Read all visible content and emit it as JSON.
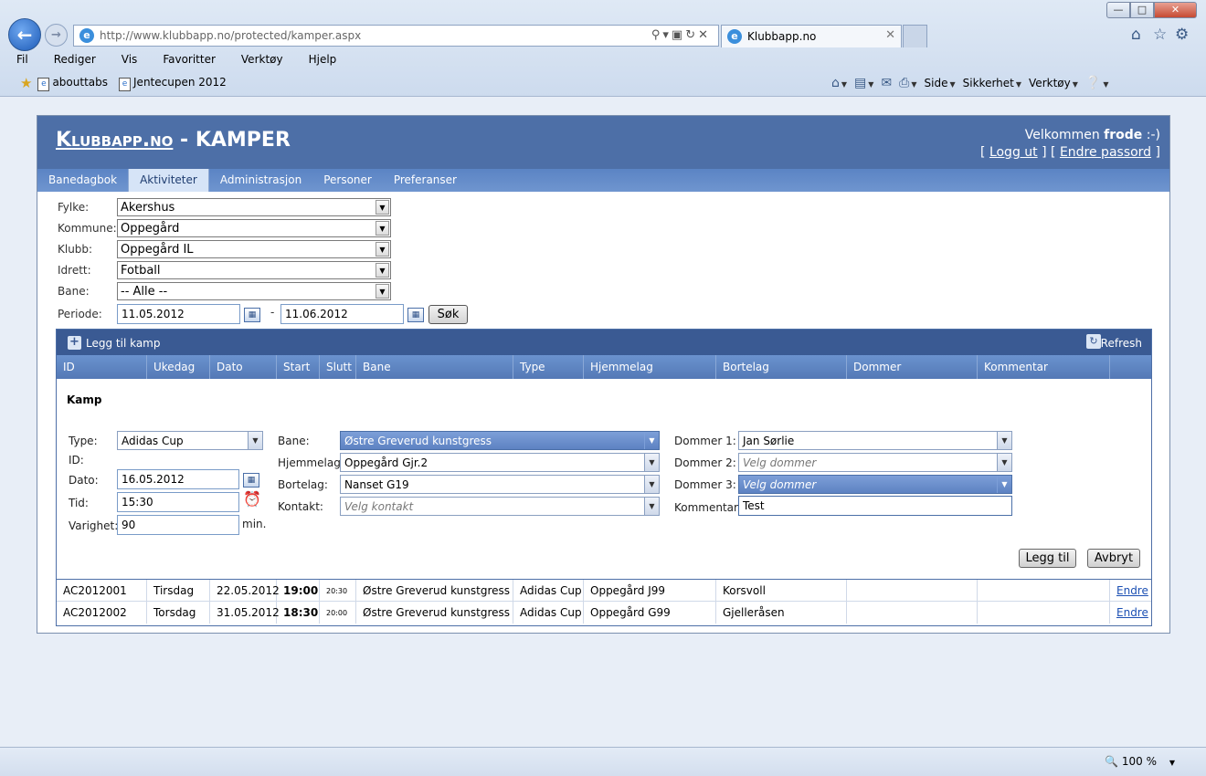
{
  "browser": {
    "url": "http://www.klubbapp.no/protected/kamper.aspx",
    "tab_title": "Klubbapp.no",
    "menu": [
      "Fil",
      "Rediger",
      "Vis",
      "Favoritter",
      "Verktøy",
      "Hjelp"
    ],
    "favorites": [
      "abouttabs",
      "Jentecupen 2012"
    ],
    "commands": [
      "Side",
      "Sikkerhet",
      "Verktøy"
    ],
    "zoom": "100 %"
  },
  "header": {
    "logo": "Klubbapp.no",
    "separator": " - ",
    "title": "KAMPER",
    "welcome_prefix": "Velkommen ",
    "username": "frode",
    "welcome_suffix": " :-)",
    "logout": "Logg ut",
    "change_password": "Endre passord"
  },
  "tabs": [
    "Banedagbok",
    "Aktiviteter",
    "Administrasjon",
    "Personer",
    "Preferanser"
  ],
  "filters": {
    "fylke_label": "Fylke:",
    "fylke": "Akershus",
    "kommune_label": "Kommune:",
    "kommune": "Oppegård",
    "klubb_label": "Klubb:",
    "klubb": "Oppegård IL",
    "idrett_label": "Idrett:",
    "idrett": "Fotball",
    "bane_label": "Bane:",
    "bane": "-- Alle --",
    "periode_label": "Periode:",
    "from": "11.05.2012",
    "dash": "-",
    "to": "11.06.2012",
    "search": "Søk"
  },
  "grid": {
    "add": "Legg til kamp",
    "refresh": "Refresh",
    "columns": [
      "ID",
      "Ukedag",
      "Dato",
      "Start",
      "Slutt",
      "Bane",
      "Type",
      "Hjemmelag",
      "Bortelag",
      "Dommer",
      "Kommentar",
      ""
    ],
    "rows": [
      {
        "id": "AC2012001",
        "ukedag": "Tirsdag",
        "dato": "22.05.2012",
        "start": "19:00",
        "slutt": "20:30",
        "bane": "Østre Greverud kunstgress",
        "type": "Adidas Cup",
        "hjemmelag": "Oppegård J99",
        "bortelag": "Korsvoll",
        "dommer": "",
        "kommentar": "",
        "action": "Endre"
      },
      {
        "id": "AC2012002",
        "ukedag": "Torsdag",
        "dato": "31.05.2012",
        "start": "18:30",
        "slutt": "20:00",
        "bane": "Østre Greverud kunstgress",
        "type": "Adidas Cup",
        "hjemmelag": "Oppegård G99",
        "bortelag": "Gjelleråsen",
        "dommer": "",
        "kommentar": "",
        "action": "Endre"
      }
    ]
  },
  "edit_form": {
    "heading": "Kamp",
    "type_label": "Type:",
    "type": "Adidas Cup",
    "id_label": "ID:",
    "dato_label": "Dato:",
    "dato": "16.05.2012",
    "tid_label": "Tid:",
    "tid": "15:30",
    "varighet_label": "Varighet:",
    "varighet": "90",
    "varighet_unit": "min.",
    "bane_label": "Bane:",
    "bane": "Østre Greverud kunstgress",
    "hjemmelag_label": "Hjemmelag:",
    "hjemmelag": "Oppegård Gjr.2",
    "bortelag_label": "Bortelag:",
    "bortelag": "Nanset G19",
    "kontakt_label": "Kontakt:",
    "kontakt_placeholder": "Velg kontakt",
    "dommer1_label": "Dommer 1:",
    "dommer1": "Jan Sørlie",
    "dommer2_label": "Dommer 2:",
    "dommer2_placeholder": "Velg dommer",
    "dommer3_label": "Dommer 3:",
    "dommer3_placeholder": "Velg dommer",
    "kommentar_label": "Kommentar:",
    "kommentar": "Test",
    "add_button": "Legg til",
    "cancel_button": "Avbryt"
  }
}
